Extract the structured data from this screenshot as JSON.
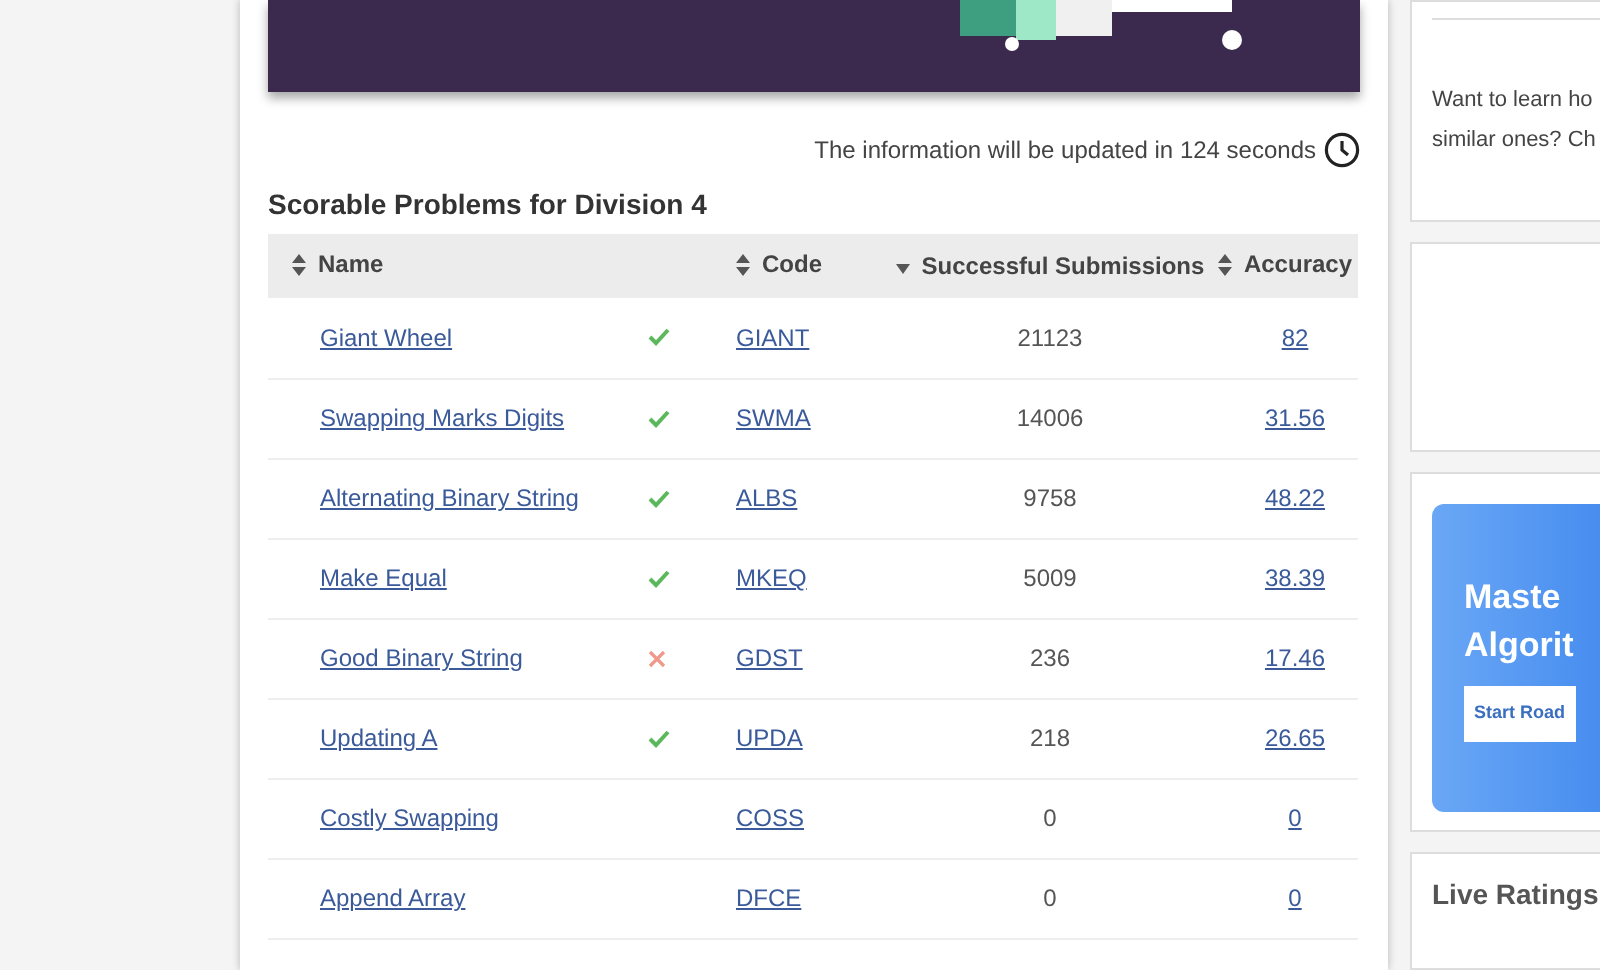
{
  "update_notice": "The information will be updated in 124 seconds",
  "section_title": "Scorable Problems for Division 4",
  "table": {
    "columns": [
      {
        "label": "Name",
        "kind": "sortable"
      },
      {
        "label": "Code",
        "kind": "sortable"
      },
      {
        "label": "Successful Submissions",
        "kind": "sorted_desc"
      },
      {
        "label": "Accuracy",
        "kind": "sortable"
      }
    ],
    "rows": [
      {
        "name": "Giant Wheel",
        "kind": "solved",
        "code": "GIANT",
        "submissions": "21123",
        "accuracy": "82"
      },
      {
        "name": "Swapping Marks Digits",
        "kind": "solved",
        "code": "SWMA",
        "submissions": "14006",
        "accuracy": "31.56"
      },
      {
        "name": "Alternating Binary String",
        "kind": "solved",
        "code": "ALBS",
        "submissions": "9758",
        "accuracy": "48.22"
      },
      {
        "name": "Make Equal",
        "kind": "solved",
        "code": "MKEQ",
        "submissions": "5009",
        "accuracy": "38.39"
      },
      {
        "name": "Good Binary String",
        "kind": "wrong",
        "code": "GDST",
        "submissions": "236",
        "accuracy": "17.46"
      },
      {
        "name": "Updating A",
        "kind": "solved",
        "code": "UPDA",
        "submissions": "218",
        "accuracy": "26.65"
      },
      {
        "name": "Costly Swapping",
        "kind": "unattempted",
        "code": "COSS",
        "submissions": "0",
        "accuracy": "0"
      },
      {
        "name": "Append Array",
        "kind": "unattempted",
        "code": "DFCE",
        "submissions": "0",
        "accuracy": "0"
      }
    ]
  },
  "sidebar": {
    "learn_text_lines": [
      "Want to learn ho",
      "similar ones? Ch"
    ],
    "promo": {
      "title_lines": [
        "Maste",
        "Algorit"
      ],
      "button": "Start Road"
    },
    "live_ratings_title": "Live Ratings"
  }
}
